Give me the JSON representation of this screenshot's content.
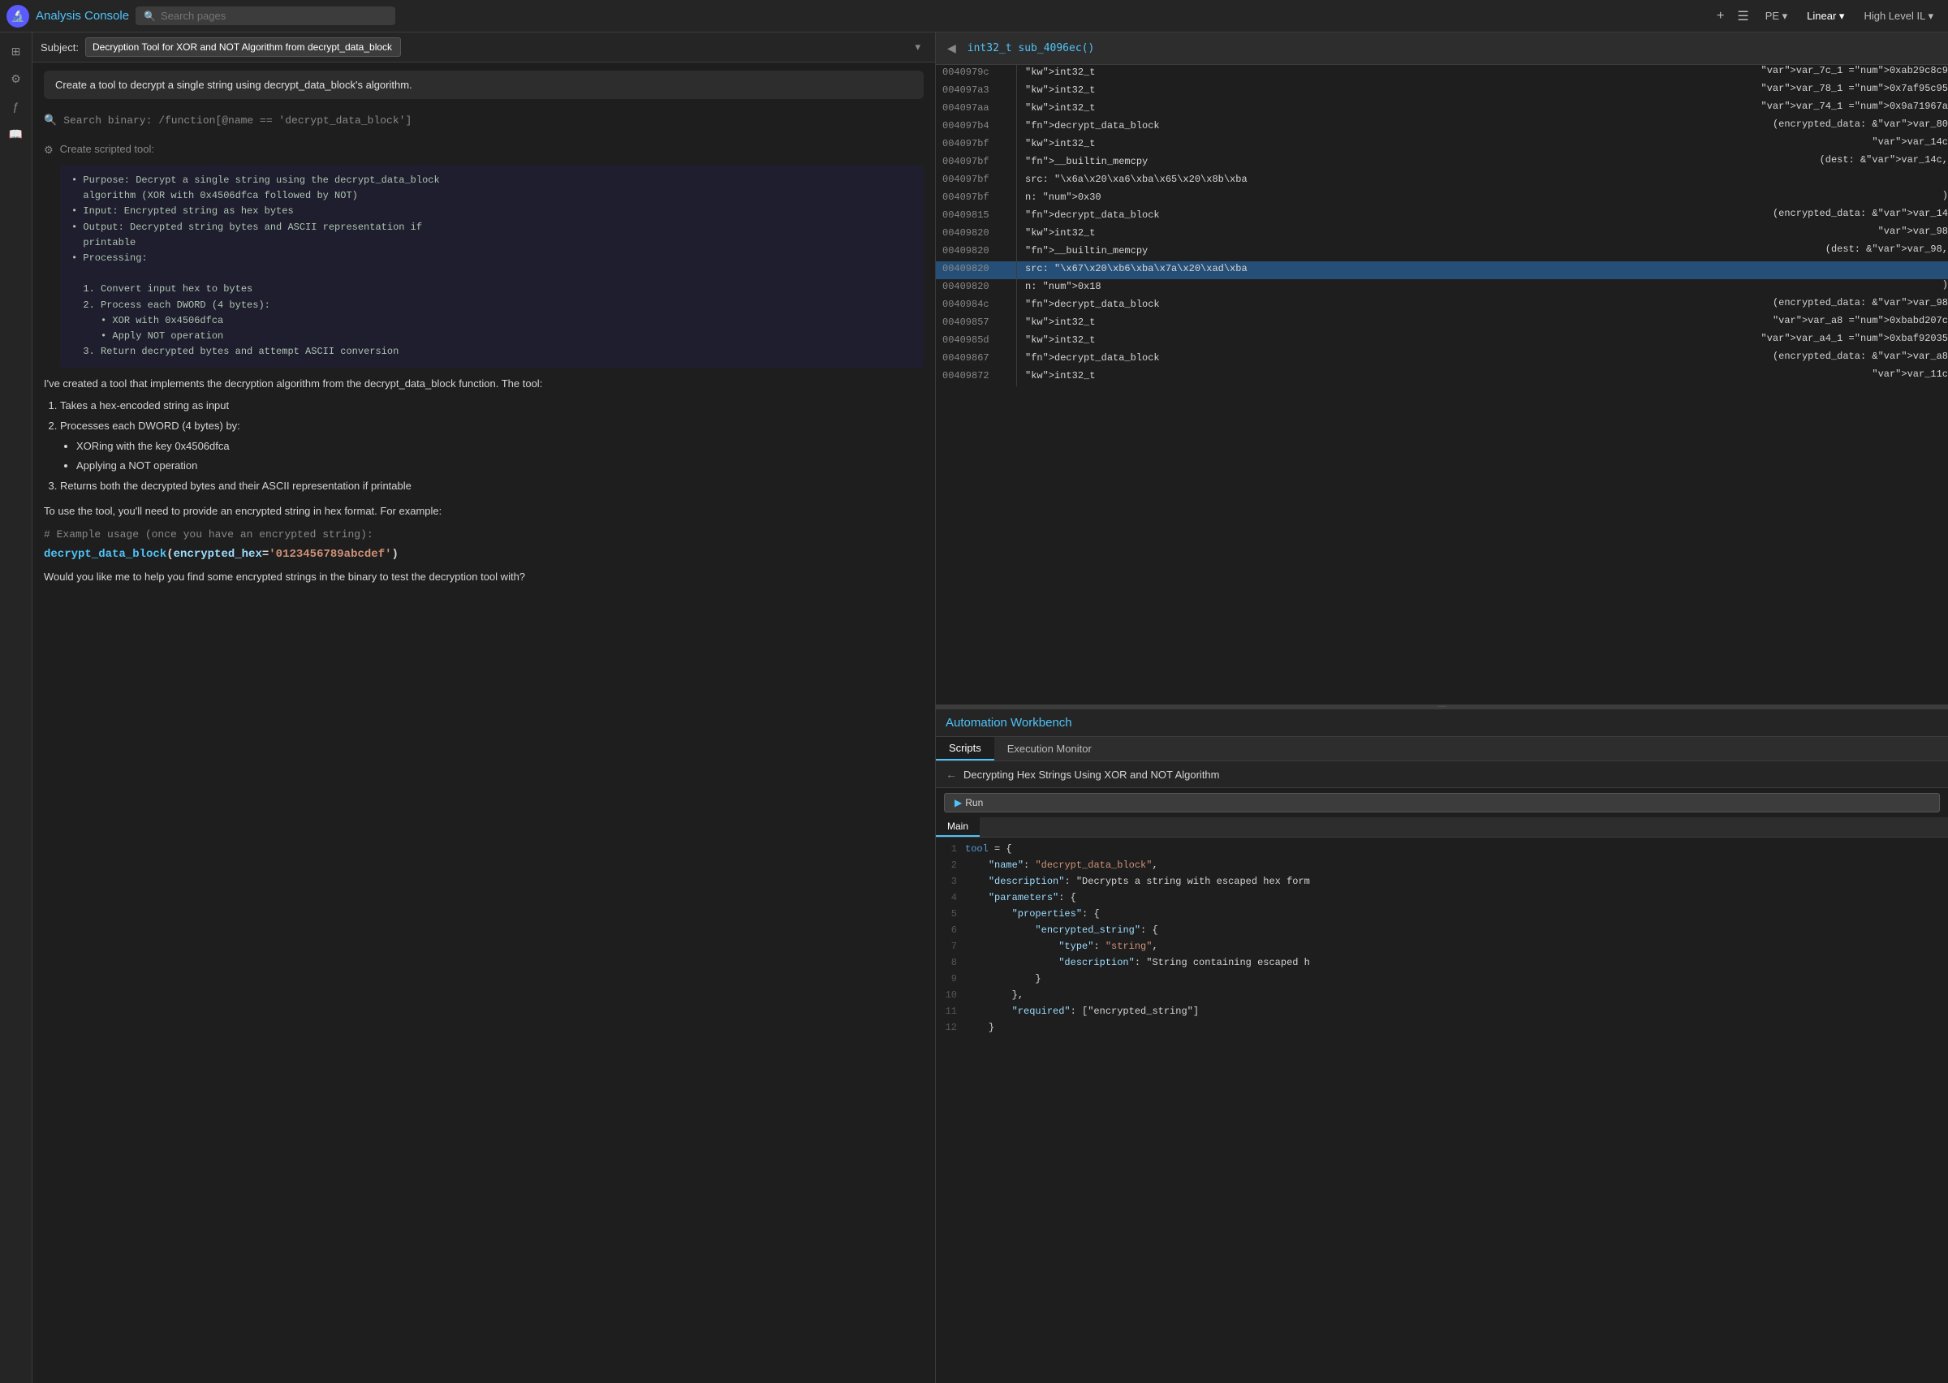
{
  "app": {
    "title": "Analysis Console",
    "icon": "🔬",
    "search_placeholder": "Search pages"
  },
  "header": {
    "func_name": "int32_t sub_4096ec()",
    "views": [
      "PE",
      "Linear",
      "High Level IL"
    ]
  },
  "subject": {
    "label": "Subject:",
    "value": "Decryption Tool for XOR and NOT Algorithm from decrypt_data_block"
  },
  "chat": {
    "tooltip": "Create a tool to decrypt a single string using decrypt_data_block's algorithm.",
    "search_text": "Search binary: /function[@name == 'decrypt_data_block']",
    "gear_text": "Create scripted tool:",
    "scripted_content": "• Purpose: Decrypt a single string using the decrypt_data_block\n  algorithm (XOR with 0x4506dfca followed by NOT)\n• Input: Encrypted string as hex bytes\n• Output: Decrypted string bytes and ASCII representation if\n  printable\n• Processing:\n\n  1. Convert input hex to bytes\n  2. Process each DWORD (4 bytes):\n     • XOR with 0x4506dfca\n     • Apply NOT operation\n  3. Return decrypted bytes and attempt ASCII conversion",
    "prose1": "I've created a tool that implements the decryption algorithm from the decrypt_data_block function. The tool:",
    "prose1_items": [
      "Takes a hex-encoded string as input",
      "Processes each DWORD (4 bytes) by:",
      "Returns both the decrypted bytes and their ASCII representation if printable"
    ],
    "sub_items": [
      "XORing with the key 0x4506dfca",
      "Applying a NOT operation"
    ],
    "prose2": "To use the tool, you'll need to provide an encrypted string in hex format. For example:",
    "example_comment": "# Example usage (once you have an encrypted string):",
    "example_call": "decrypt_data_block(encrypted_hex='0123456789abcdef')",
    "prose3": "Would you like me to help you find some encrypted strings in the binary to test the decryption tool with?"
  },
  "disasm": {
    "rows": [
      {
        "addr": "0040979c",
        "code": "int32_t var_7c_1 = 0xab29c8c9",
        "highlighted": false
      },
      {
        "addr": "004097a3",
        "code": "int32_t var_78_1 = 0x7af95c95",
        "highlighted": false
      },
      {
        "addr": "004097aa",
        "code": "int32_t var_74_1 = 0x9a71967a",
        "highlighted": false
      },
      {
        "addr": "004097b4",
        "code": "decrypt_data_block(encrypted_data: &var_80",
        "highlighted": false
      },
      {
        "addr": "004097bf",
        "code": "int32_t var_14c",
        "highlighted": false
      },
      {
        "addr": "004097bf",
        "code": "__builtin_memcpy(dest: &var_14c,",
        "highlighted": false
      },
      {
        "addr": "004097bf",
        "code": "    src: \"\\x6a\\x20\\xa6\\xba\\x65\\x20\\x8b\\xba",
        "highlighted": false
      },
      {
        "addr": "004097bf",
        "code": "    n: 0x30)",
        "highlighted": false
      },
      {
        "addr": "00409815",
        "code": "decrypt_data_block(encrypted_data: &var_14",
        "highlighted": false
      },
      {
        "addr": "00409820",
        "code": "int32_t var_98",
        "highlighted": false
      },
      {
        "addr": "00409820",
        "code": "__builtin_memcpy(dest: &var_98,",
        "highlighted": false
      },
      {
        "addr": "00409820",
        "code": "    src: \"\\x67\\x20\\xb6\\xba\\x7a\\x20\\xad\\xba",
        "highlighted": true
      },
      {
        "addr": "00409820",
        "code": "    n: 0x18)",
        "highlighted": false
      },
      {
        "addr": "0040984c",
        "code": "decrypt_data_block(encrypted_data: &var_98",
        "highlighted": false
      },
      {
        "addr": "00409857",
        "code": "int32_t var_a8 = 0xbabd207c",
        "highlighted": false
      },
      {
        "addr": "0040985d",
        "code": "int32_t var_a4_1 = 0xbaf92035",
        "highlighted": false
      },
      {
        "addr": "00409867",
        "code": "decrypt_data_block(encrypted_data: &var_a8",
        "highlighted": false
      },
      {
        "addr": "00409872",
        "code": "int32_t var_11c",
        "highlighted": false
      }
    ]
  },
  "automation": {
    "title": "Automation Workbench",
    "tabs": [
      "Scripts",
      "Execution Monitor"
    ],
    "active_tab": "Scripts",
    "back_label": "Decrypting Hex Strings Using XOR and NOT Algorithm",
    "run_label": "Run",
    "code_tabs": [
      "Main"
    ],
    "active_code_tab": "Main",
    "code_lines": [
      {
        "num": 1,
        "text": "tool = {"
      },
      {
        "num": 2,
        "text": "    \"name\": \"decrypt_data_block\","
      },
      {
        "num": 3,
        "text": "    \"description\": \"Decrypts a string with escaped hex form"
      },
      {
        "num": 4,
        "text": "    \"parameters\": {"
      },
      {
        "num": 5,
        "text": "        \"properties\": {"
      },
      {
        "num": 6,
        "text": "            \"encrypted_string\": {"
      },
      {
        "num": 7,
        "text": "                \"type\": \"string\","
      },
      {
        "num": 8,
        "text": "                \"description\": \"String containing escaped h"
      },
      {
        "num": 9,
        "text": "            }"
      },
      {
        "num": 10,
        "text": "        },"
      },
      {
        "num": 11,
        "text": "        \"required\": [\"encrypted_string\"]"
      },
      {
        "num": 12,
        "text": "    }"
      }
    ]
  },
  "sidebar": {
    "icons": [
      "⊞",
      "⚙",
      "⟳",
      "📖"
    ]
  }
}
